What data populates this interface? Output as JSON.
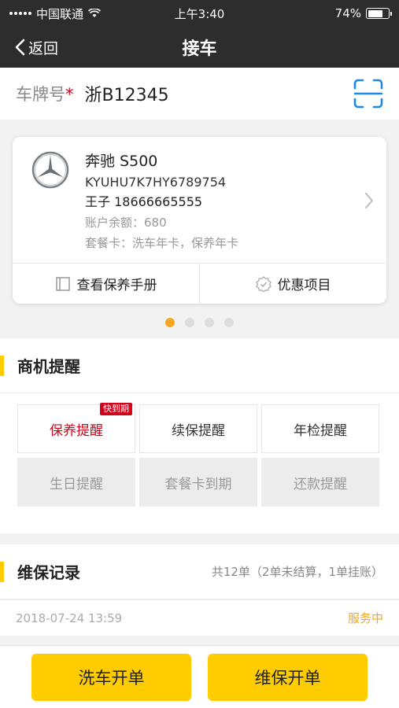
{
  "statusbar": {
    "carrier": "中国联通",
    "time": "上午3:40",
    "battery": "74%",
    "battery_level": 0.74
  },
  "nav": {
    "back_label": "返回",
    "title": "接车"
  },
  "plate": {
    "label": "车牌号",
    "required_mark": "*",
    "value": "浙B12345",
    "scan_icon": "scan-icon"
  },
  "vehicle": {
    "name": "奔驰 S500",
    "vin": "KYUHU7K7HY6789754",
    "owner": "王子 18666665555",
    "balance": "账户余额：680",
    "package": "套餐卡：洗车年卡，保养年卡",
    "actions": [
      {
        "label": "查看保养手册",
        "icon": "manual-icon"
      },
      {
        "label": "优惠项目",
        "icon": "discount-check-icon"
      }
    ]
  },
  "carousel": {
    "count": 4,
    "active": 0
  },
  "opportunities": {
    "title": "商机提醒",
    "items": [
      {
        "label": "保养提醒",
        "badge": "快到期",
        "state": "alert"
      },
      {
        "label": "续保提醒",
        "state": "normal"
      },
      {
        "label": "年检提醒",
        "state": "normal"
      },
      {
        "label": "生日提醒",
        "state": "disabled"
      },
      {
        "label": "套餐卡到期",
        "state": "disabled"
      },
      {
        "label": "还款提醒",
        "state": "disabled"
      }
    ]
  },
  "maintenance": {
    "title": "维保记录",
    "summary": "共12单（2单未结算，1单挂账）",
    "records": [
      {
        "date": "2018-07-24 13:59",
        "status": "服务中"
      }
    ]
  },
  "bottom": {
    "wash_label": "洗车开单",
    "repair_label": "维保开单"
  },
  "colors": {
    "accent": "#ffcc00",
    "dark_bar": "#2d2d2d",
    "alert_red": "#d0021b",
    "status_orange": "#f5a623",
    "scan_blue": "#1e88e5"
  }
}
